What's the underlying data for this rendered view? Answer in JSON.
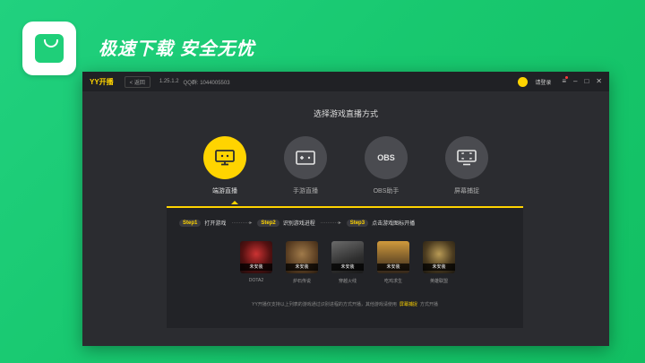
{
  "promo": {
    "slogan": "极速下载  安全无忧",
    "icon": "shopping-bag-icon"
  },
  "window": {
    "logo": "YY开播",
    "back_label": "< 返回",
    "version": "1.25.1.2",
    "qq": "QQ群: 1044005503",
    "login_label": "请登录",
    "controls": {
      "menu": "≡",
      "minimize": "–",
      "maximize": "□",
      "close": "✕"
    }
  },
  "heading": "选择游戏直播方式",
  "modes": [
    {
      "label": "端游直播",
      "icon": "pc-game-icon",
      "glyph": "",
      "active": true
    },
    {
      "label": "手游直播",
      "icon": "mobile-game-icon",
      "glyph": "",
      "active": false
    },
    {
      "label": "OBS助手",
      "icon": "obs-icon",
      "glyph": "OBS",
      "active": false
    },
    {
      "label": "屏幕捕捉",
      "icon": "screen-capture-icon",
      "glyph": "",
      "active": false
    }
  ],
  "steps": [
    {
      "badge": "Step1",
      "text": "打开游戏"
    },
    {
      "badge": "Step2",
      "text": "识别游戏进程"
    },
    {
      "badge": "Step3",
      "text": "点击游戏图标开播"
    }
  ],
  "step_separator": "··········▸",
  "games": [
    {
      "name": "DOTA2",
      "status": "未安装"
    },
    {
      "name": "炉石传说",
      "status": "未安装"
    },
    {
      "name": "穿越火线",
      "status": "未安装"
    },
    {
      "name": "吃鸡求生",
      "status": "未安装"
    },
    {
      "name": "英雄联盟",
      "status": "未安装"
    }
  ],
  "footnote": {
    "prefix": "YY开播仅支持以上列表的游戏通过识别进程的方式开播，其他游戏请使用",
    "link": "屏幕捕捉",
    "suffix": "方式开播"
  },
  "colors": {
    "accent": "#ffd400",
    "background": "#1fcf79",
    "window": "#2b2c30"
  }
}
